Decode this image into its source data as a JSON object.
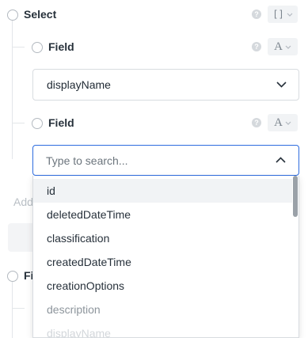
{
  "select_node": {
    "label": "Select",
    "type_symbol": "[]"
  },
  "field_nodes": [
    {
      "label": "Field",
      "type_symbol": "A"
    },
    {
      "label": "Field",
      "type_symbol": "A"
    }
  ],
  "bottom_node": {
    "label": "Fi"
  },
  "help_icon_glyph": "?",
  "field_value_select": {
    "value": "displayName"
  },
  "search": {
    "placeholder": "Type to search..."
  },
  "add_link": {
    "label": "Add"
  },
  "options": [
    "id",
    "deletedDateTime",
    "classification",
    "createdDateTime",
    "creationOptions",
    "description",
    "displayName"
  ],
  "colors": {
    "focus_border": "#2d6cdf",
    "highlight_row": "#f1f3f5",
    "scroll_thumb": "#9aa1a8"
  }
}
